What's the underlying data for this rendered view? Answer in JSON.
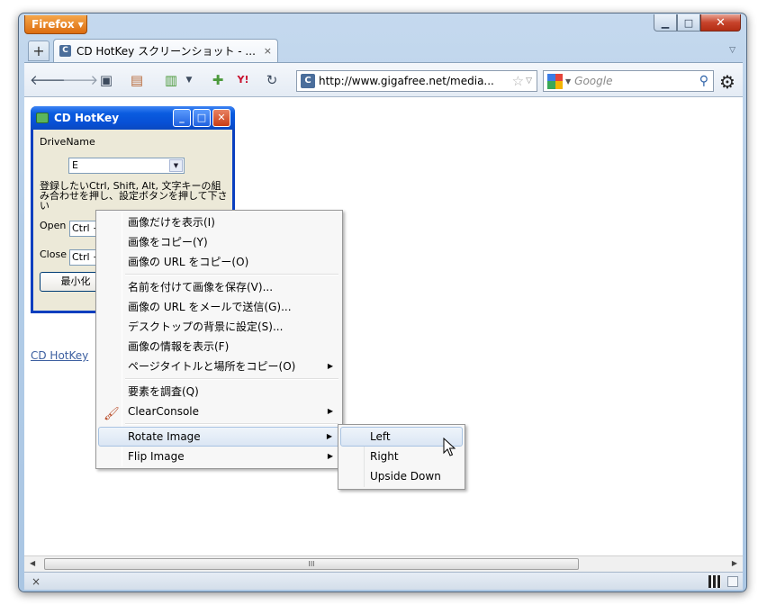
{
  "browser": {
    "menu_button": "Firefox",
    "tab_title": "CD HotKey スクリーンショット - ...",
    "url": "http://www.gigafree.net/media...",
    "search_placeholder": "Google",
    "new_tab_glyph": "+",
    "tab_close_glyph": "×",
    "status_close_glyph": "×",
    "scroll_thumb_glyph": "III"
  },
  "hotkey_window": {
    "title": "CD HotKey",
    "drive_label": "DriveName",
    "drive_value": "E",
    "description": "登録したいCtrl, Shift, Alt, 文字キーの組み合わせを押し、設定ボタンを押して下さい",
    "open_label": "Open",
    "open_value": "Ctrl +",
    "close_label": "Close",
    "close_value": "Ctrl +",
    "minimize_button": "最小化"
  },
  "page": {
    "link_text": "CD HotKey"
  },
  "context_menu": {
    "items": [
      {
        "label": "画像だけを表示(I)"
      },
      {
        "label": "画像をコピー(Y)"
      },
      {
        "label": "画像の URL をコピー(O)"
      },
      {
        "label": "名前を付けて画像を保存(V)..."
      },
      {
        "label": "画像の URL をメールで送信(G)..."
      },
      {
        "label": "デスクトップの背景に設定(S)..."
      },
      {
        "label": "画像の情報を表示(F)"
      },
      {
        "label": "ページタイトルと場所をコピー(O)"
      },
      {
        "label": "要素を調査(Q)"
      },
      {
        "label": "ClearConsole"
      },
      {
        "label": "Rotate Image"
      },
      {
        "label": "Flip Image"
      }
    ],
    "submenu_arrow": "▶"
  },
  "rotate_submenu": {
    "items": [
      {
        "label": "Left"
      },
      {
        "label": "Right"
      },
      {
        "label": "Upside Down"
      }
    ]
  },
  "icons": {
    "back": "back-arrow-icon",
    "forward": "forward-arrow-icon",
    "bookmarks": "bookmark-star-icon",
    "reload": "reload-icon",
    "tools": "gear-icon"
  },
  "colors": {
    "firefox_orange": "#e77a1b",
    "xp_title_blue": "#0a5ce0",
    "link_blue": "#3c5fa0",
    "menu_highlight": "#dbe6f4"
  }
}
